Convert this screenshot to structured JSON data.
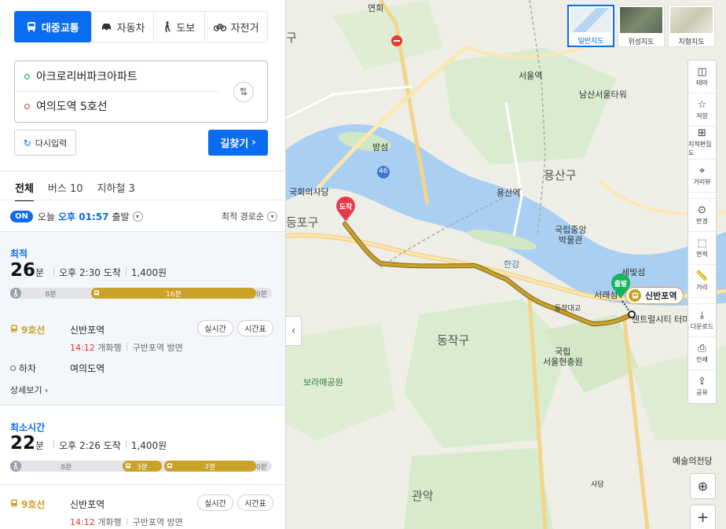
{
  "transport_modes": [
    {
      "label": "대중교통",
      "active": true
    },
    {
      "label": "자동차",
      "active": false
    },
    {
      "label": "도보",
      "active": false
    },
    {
      "label": "자전거",
      "active": false
    }
  ],
  "route": {
    "origin": "아크로리버파크아파트",
    "destination": "여의도역 5호선",
    "reset_label": "다시입력",
    "search_label": "길찾기"
  },
  "result_tabs": [
    {
      "label": "전체",
      "active": true
    },
    {
      "label": "버스 10",
      "active": false
    },
    {
      "label": "지하철 3",
      "active": false
    }
  ],
  "departure": {
    "toggle": "ON",
    "day": "오늘",
    "time": "오후 01:57",
    "suffix": "출발",
    "sort_label": "최적 경로순"
  },
  "results": [
    {
      "label": "최적",
      "minutes": "26",
      "unit": "분",
      "arrival": "오후 2:30 도착",
      "fare": "1,400원",
      "segments": {
        "walk": "8분",
        "bus": "16분",
        "end": "0분"
      },
      "line": "9호선",
      "board_stop": "신반포역",
      "board_time": "14:12",
      "board_dir": "개화행",
      "board_desc": "구반포역 방면",
      "realtime_label": "실시간",
      "timetable_label": "시간표",
      "alight_label": "하차",
      "alight_stop": "여의도역",
      "detail_label": "상세보기"
    },
    {
      "label": "최소시간",
      "minutes": "22",
      "unit": "분",
      "arrival": "오후 2:26 도착",
      "fare": "1,400원",
      "segments": {
        "walk": "8분",
        "bus1": "3분",
        "bus2": "7분",
        "end": "0분"
      },
      "line": "9호선",
      "board_stop": "신반포역",
      "board_time": "14:12",
      "board_dir": "개화행",
      "board_desc": "구반포역 방면",
      "realtime_label": "실시간",
      "timetable_label": "시간표"
    }
  ],
  "map": {
    "types": [
      "일반지도",
      "위성지도",
      "지형지도"
    ],
    "tools": [
      "테마",
      "저장",
      "지적편집도",
      "거리뷰",
      "반경",
      "면적",
      "거리",
      "다운로드",
      "인쇄",
      "공유"
    ],
    "labels": {
      "yeonhui": "연희",
      "seoul_station": "서울역",
      "namsan_tower": "남산서울타워",
      "bamseom": "밤섬",
      "route46": "46",
      "yongsan_gu": "용산구",
      "yongsan_station": "용산역",
      "national_museum": "국립중앙\n박물관",
      "national_assembly": "국회의사당",
      "yeongdeungpo_gu": "등포구",
      "hangang": "한강",
      "dongjak_bridge": "동작대교",
      "sebitseom": "세빛섬",
      "seorae": "서래섬",
      "dongjak_gu": "동작구",
      "national_cemetery": "국립\n서울현충원",
      "boramae": "보라매공원",
      "central_city": "센트럴시티 터미널",
      "arts_center": "예술의전당",
      "gwanak": "관악",
      "sadang": "사당",
      "gu_edge": "구"
    },
    "markers": {
      "start": "출발",
      "end": "도착",
      "station": "신반포역"
    },
    "zoom_in": "+"
  }
}
